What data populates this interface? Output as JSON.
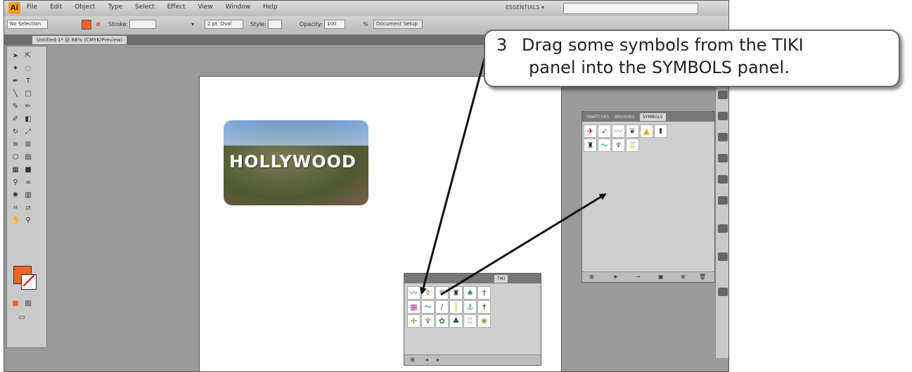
{
  "app": {
    "logo": "Ai",
    "menus": [
      "File",
      "Edit",
      "Object",
      "Type",
      "Select",
      "Effect",
      "View",
      "Window",
      "Help"
    ],
    "workspace": "ESSENTIALS ▾"
  },
  "control_bar": {
    "selection": "No Selection",
    "stroke_label": "Stroke:",
    "brush": "2 pt. Oval",
    "style_label": "Style:",
    "opacity_label": "Opacity:",
    "opacity_value": "100",
    "percent": "%",
    "document_setup": "Document Setup",
    "colors": {
      "fill": "#f26522"
    }
  },
  "document_tab": "Untitled-1* @ 66% (CMYK/Preview)",
  "canvas_image": {
    "sign_text": "HOLLYWOOD"
  },
  "symbols_panel": {
    "tabs": [
      "SWATCHES",
      "BRUSHES",
      "SYMBOLS"
    ],
    "active_tab": "SYMBOLS",
    "footer_buttons": [
      "library-icon",
      "place-icon",
      "break-link-icon",
      "options-icon",
      "new-symbol-icon",
      "delete-icon"
    ]
  },
  "tiki_panel": {
    "tab": "TIKI"
  },
  "callout": {
    "number": "3",
    "line1": "Drag some symbols from the TIKI",
    "line2": "panel into the SYMBOLS panel."
  }
}
